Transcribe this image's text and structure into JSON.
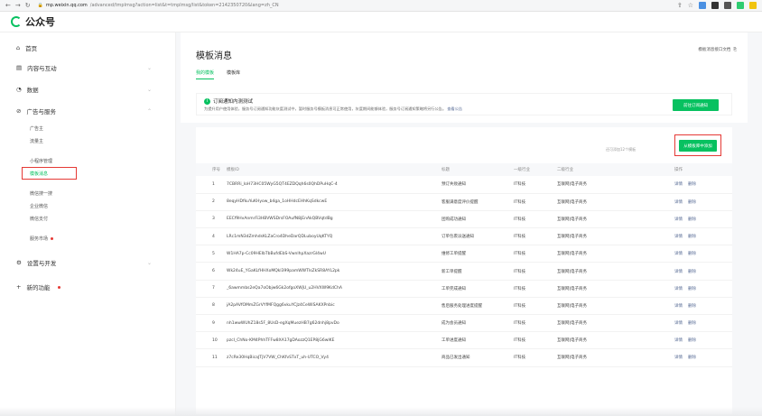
{
  "browser": {
    "url_host": "mp.weixin.qq.com",
    "url_path": "/advanced/tmplmsg?action=list&t=tmplmsg/list&token=2142350720&lang=zh_CN"
  },
  "header": {
    "logo_text": "公众号"
  },
  "sidebar": {
    "items": [
      {
        "label": "首页",
        "icon": "home-icon"
      },
      {
        "label": "内容与互动",
        "icon": "document-icon"
      },
      {
        "label": "数据",
        "icon": "data-icon"
      },
      {
        "label": "广告与服务",
        "icon": "ad-icon"
      },
      {
        "label": "设置与开发",
        "icon": "settings-icon"
      },
      {
        "label": "新的功能",
        "icon": "plus-icon"
      }
    ],
    "sub_items": [
      "广告主",
      "流量主",
      "小程序管理",
      "模板消息",
      "微信搜一搜",
      "企业微信",
      "微信支付",
      "服务市场"
    ]
  },
  "page": {
    "title": "模板消息",
    "doc_link": "模板消息接口文档",
    "tabs": [
      "我的模板",
      "模板库"
    ]
  },
  "notice": {
    "title": "订阅通知内测测试",
    "desc": "为提升用户使用体验，服务号订阅通知功能灰度测试中，暂时服务号模板消息可正常使用，灰度期间能够体验，服务号订阅通知策略将另行公告。",
    "link": "查看公告",
    "button": "前往订阅通知"
  },
  "list": {
    "add_info": "还可添加12个模板",
    "add_button": "从模板库中添加",
    "columns": [
      "序号",
      "模板ID",
      "标题",
      "一级行业",
      "二级行业",
      "操作"
    ],
    "op_detail": "详情",
    "op_delete": "删除",
    "rows": [
      {
        "no": "1",
        "id": "7CBRRi_IoH73HC05WyG5QT4EZDQqh6s0QhDPuHqC-4",
        "title": "预订失败通知",
        "ind1": "IT科技",
        "ind2": "互联网|电子商务"
      },
      {
        "no": "2",
        "id": "8eqyHDfkuYuKHyow_b4ga_1oHHdcEHhKqSdkcwE",
        "title": "客服满意度评价提醒",
        "ind1": "IT科技",
        "ind2": "互联网|电子商务"
      },
      {
        "no": "3",
        "id": "EECf9HvAnmrFi3HBVWSDrsFOAufN8jEnAkQBVqtdBg",
        "title": "团购成功通知",
        "ind1": "IT科技",
        "ind2": "互联网|电子商务"
      },
      {
        "no": "4",
        "id": "LRc1mN3dZmhdsKLZaCro4DheDarQDLuboyUqKTYQ",
        "title": "订单包裹派送通知",
        "ind1": "IT科技",
        "ind2": "互联网|电子商务"
      },
      {
        "no": "5",
        "id": "W1HA7p-Cc09HEIbTbBufdEbS-VwnlhpXazrGl4wU",
        "title": "维修工单提醒",
        "ind1": "IT科技",
        "ind2": "互联网|电子商务"
      },
      {
        "no": "6",
        "id": "Wk24uE_YGaKLfHHXoMQkl399pamWWTIsZkSR8AYL2pk",
        "title": "新工单提醒",
        "ind1": "IT科技",
        "ind2": "互联网|电子商务"
      },
      {
        "no": "7",
        "id": "_6awmmbs2eQa7oObjw6Gk2ofgoXWjU_u2HVXW9KdChA",
        "title": "工单完成通知",
        "ind1": "IT科技",
        "ind2": "互联网|电子商务"
      },
      {
        "no": "8",
        "id": "jA2pAVfOMmZGrVYfMFQgg6vkuYCJz4CeWISAKXPnbic",
        "title": "售后服务处理进度提醒",
        "ind1": "IT科技",
        "ind2": "互联网|电子商务"
      },
      {
        "no": "9",
        "id": "nh1wwWUhZ18s5F_8UsD-egXqMuezHB7g62dnhj8pvDo",
        "title": "成为会员通知",
        "ind1": "IT科技",
        "ind2": "互联网|电子商务"
      },
      {
        "no": "10",
        "id": "pzcI_ChNo-KM4PhhTFFw8XA17gDAozzQ1EP8jG6wlKE",
        "title": "工单进度通知",
        "ind1": "IT科技",
        "ind2": "互联网|电子商务"
      },
      {
        "no": "11",
        "id": "z7cRe30HqBicaJTjV7VW_ChKfvSTxT_uh-UTCO_Vy4",
        "title": "商品已发出通知",
        "ind1": "IT科技",
        "ind2": "互联网|电子商务"
      }
    ]
  },
  "colors": {
    "accent": "#07c160",
    "highlight": "#e53935",
    "link": "#576b95"
  }
}
